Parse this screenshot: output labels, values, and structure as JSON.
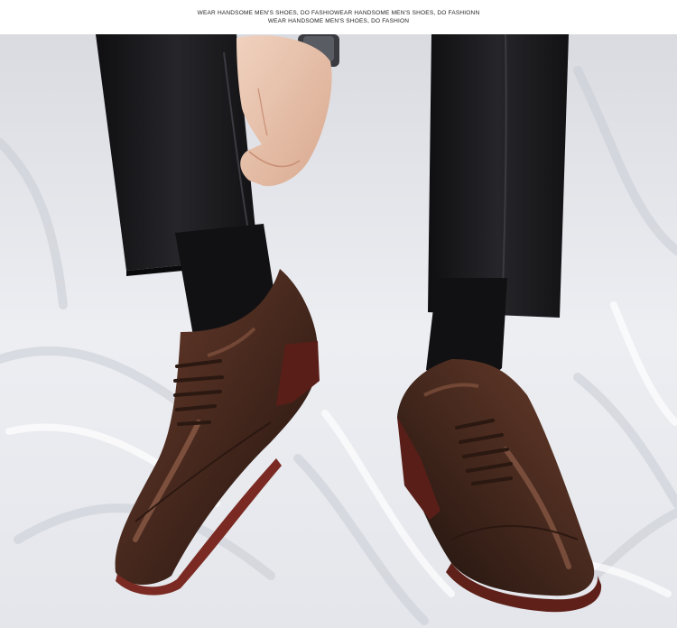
{
  "banner": {
    "line1": "WEAR HANDSOME MEN'S SHOES, DO FASHIOWEAR HANDSOME MEN'S SHOES, DO FASHIONN",
    "line2": "WEAR HANDSOME MEN'S SHOES, DO FASHION"
  },
  "colors": {
    "backdrop": "#e9eaee",
    "trousers": "#1a1a1d",
    "socks": "#0f0f10",
    "leather": "#4a2a1f",
    "sole_edge": "#7a2a22",
    "skin": "#e7c4ad"
  }
}
